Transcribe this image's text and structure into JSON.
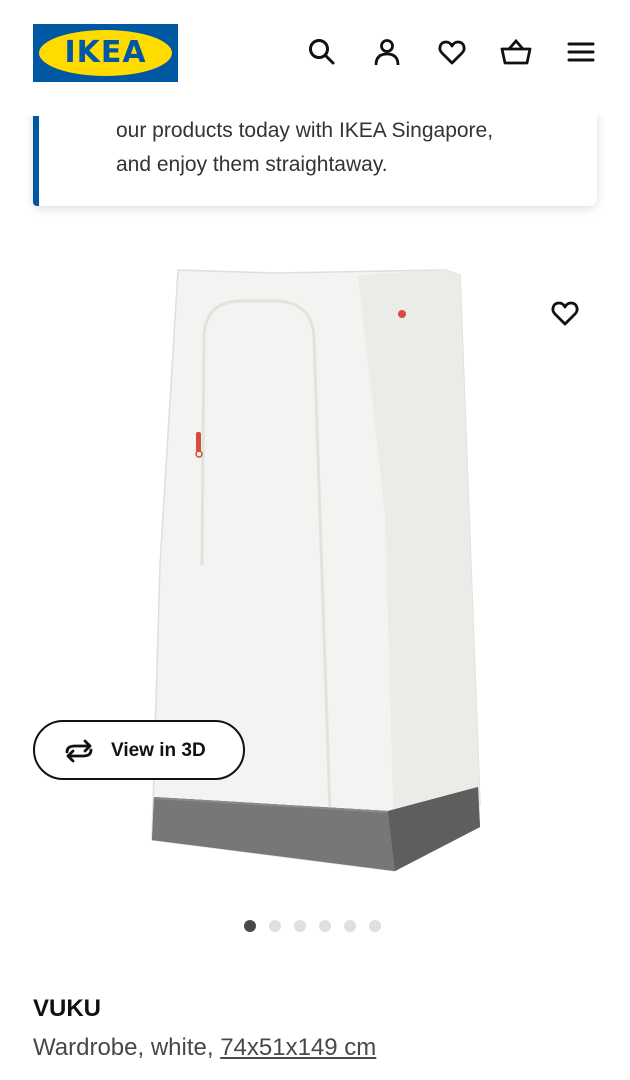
{
  "header": {
    "logo_text": "IKEA",
    "icons": [
      "search-icon",
      "account-icon",
      "heart-icon",
      "basket-icon",
      "menu-icon"
    ]
  },
  "banner": {
    "line1": "our products today with IKEA Singapore,",
    "line2": "and enjoy them straightaway."
  },
  "product": {
    "view_3d_label": "View in 3D",
    "gallery_count": 6,
    "gallery_active_index": 0,
    "name": "VUKU",
    "description_prefix": "Wardrobe, white, ",
    "dimensions": "74x51x149 cm"
  },
  "colors": {
    "brand_blue": "#0058a3",
    "brand_yellow": "#ffdb00",
    "accent_red": "#e04a3a"
  }
}
